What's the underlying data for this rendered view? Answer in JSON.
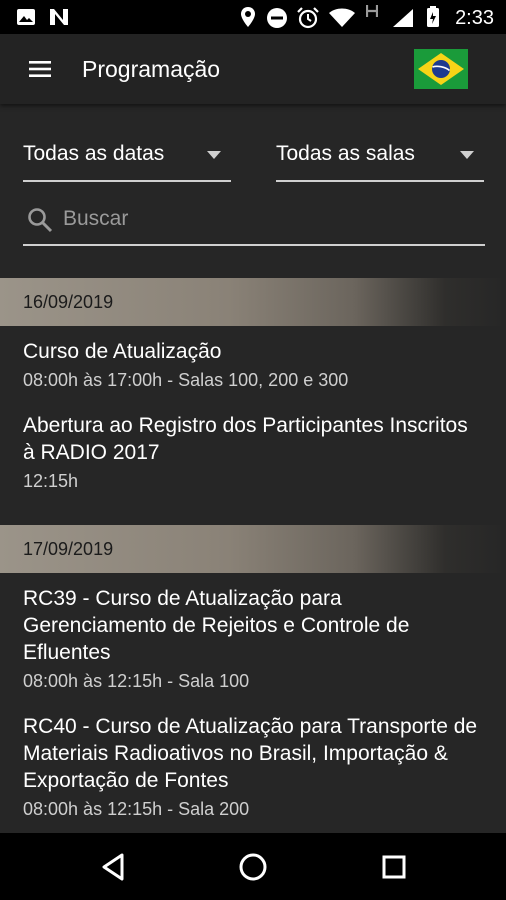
{
  "status_bar": {
    "time": "2:33",
    "icons": [
      "image-icon",
      "n-icon",
      "location-icon",
      "do-not-disturb-icon",
      "alarm-icon",
      "wifi-icon",
      "h-signal-icon",
      "cell-signal-icon",
      "battery-icon"
    ]
  },
  "app_bar": {
    "title": "Programação",
    "menu_icon": "hamburger-menu-icon",
    "language_flag": "brazil-flag-icon"
  },
  "filters": {
    "dates_selected": "Todas as datas",
    "rooms_selected": "Todas as salas"
  },
  "search": {
    "placeholder": "Buscar",
    "value": ""
  },
  "schedule": [
    {
      "date": "16/09/2019",
      "events": [
        {
          "title": "Curso de Atualização",
          "time": "08:00h às 17:00h - Salas 100, 200 e 300"
        },
        {
          "title": "Abertura ao Registro dos Participantes Inscritos à RADIO 2017",
          "time": "12:15h"
        }
      ]
    },
    {
      "date": "17/09/2019",
      "events": [
        {
          "title": "RC39 - Curso de Atualização para Gerenciamento de Rejeitos e Controle de Efluentes",
          "time": "08:00h às 12:15h - Sala 100"
        },
        {
          "title": "RC40 - Curso de Atualização para Transporte de Materiais Radioativos no Brasil, Importação & Exportação de Fontes",
          "time": "08:00h às 12:15h - Sala 200"
        }
      ]
    }
  ],
  "nav_bar": {
    "buttons": [
      "back-icon",
      "home-icon",
      "recents-icon"
    ]
  },
  "colors": {
    "background": "#262626",
    "app_bar": "#232323",
    "date_header": "#9b9489",
    "text_primary": "#ffffff",
    "text_secondary": "#cfcfcf"
  }
}
